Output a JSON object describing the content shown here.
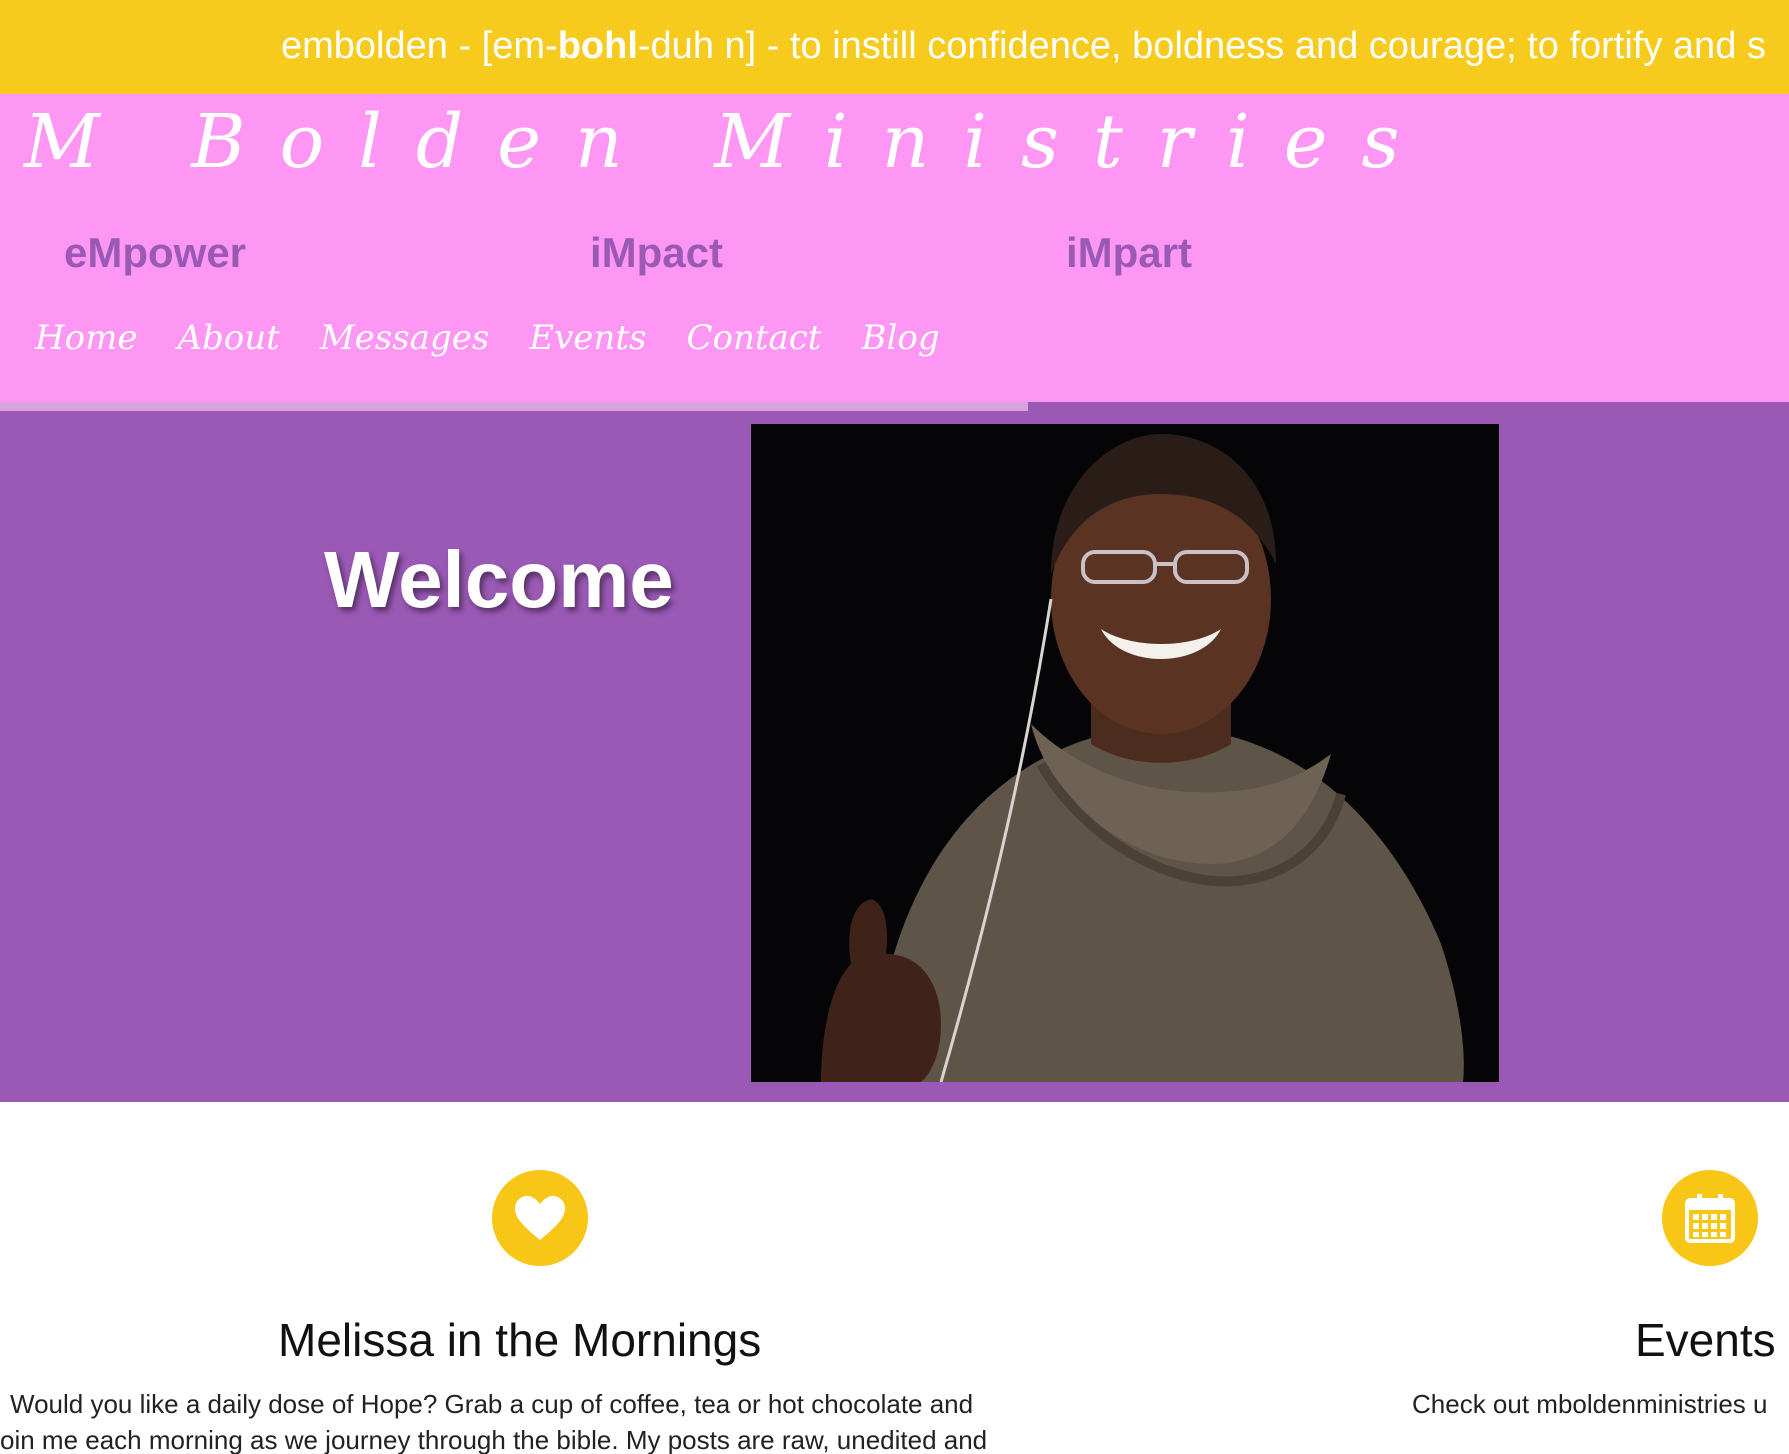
{
  "banner": {
    "word": "embolden",
    "sep1": " - [em-",
    "syllable": "bohl",
    "rest": "-duh n] - to instill confidence, boldness and courage; to fortify and s"
  },
  "header": {
    "site_title": "M Bolden Ministries",
    "taglines": [
      "eMpower",
      "iMpact",
      "iMpart"
    ],
    "nav": [
      "Home",
      "About",
      "Messages",
      "Events",
      "Contact",
      "Blog"
    ]
  },
  "hero": {
    "heading": "Welcome",
    "photo_alt": "Photo of a smiling woman with glasses giving a thumbs up"
  },
  "features": [
    {
      "icon": "heart-icon",
      "title": "Melissa in the Mornings",
      "body_line1": "Would you like a daily dose of Hope?  Grab a cup of coffee, tea or hot chocolate and",
      "body_line2": "oin me each morning as we journey through the bible.  My posts are raw, unedited and"
    },
    {
      "icon": "calendar-icon",
      "title": "Events",
      "body_line1": "Check out mboldenministries u"
    }
  ],
  "colors": {
    "banner": "#f7cb1d",
    "header": "#fe97f4",
    "hero": "#9a59b5",
    "accent": "#f7c617",
    "tagline": "#9b59b6"
  }
}
